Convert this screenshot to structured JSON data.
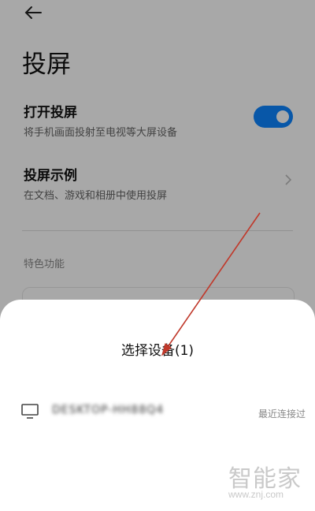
{
  "page": {
    "title": "投屏"
  },
  "settings": {
    "cast": {
      "title": "打开投屏",
      "subtitle": "将手机画面投射至电视等大屏设备",
      "enabled": true
    },
    "example": {
      "title": "投屏示例",
      "subtitle": "在文档、游戏和相册中使用投屏"
    }
  },
  "section": {
    "features_label": "特色功能"
  },
  "sheet": {
    "title": "选择设备(1)",
    "devices": [
      {
        "name": "DESKTOP-HH88Q4",
        "status": "最近连接过",
        "icon": "monitor-icon"
      }
    ]
  },
  "watermark": {
    "logo": "智能家",
    "url": "www.znj.com"
  },
  "colors": {
    "accent": "#0d84ff",
    "annotation_arrow": "#c0392b"
  }
}
